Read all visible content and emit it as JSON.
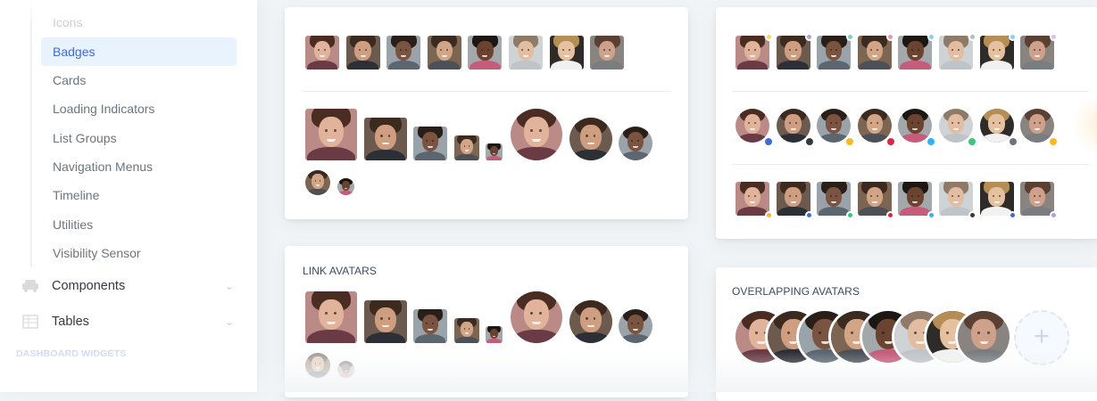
{
  "sidebar": {
    "items": [
      {
        "label": "Icons",
        "state": "faded"
      },
      {
        "label": "Badges",
        "state": "active"
      },
      {
        "label": "Cards"
      },
      {
        "label": "Loading Indicators"
      },
      {
        "label": "List Groups"
      },
      {
        "label": "Navigation Menus"
      },
      {
        "label": "Timeline"
      },
      {
        "label": "Utilities"
      },
      {
        "label": "Visibility Sensor"
      }
    ],
    "groups": [
      {
        "label": "Components",
        "icon": "car-icon"
      },
      {
        "label": "Tables",
        "icon": "table-icon"
      }
    ],
    "section_heading": "DASHBOARD WIDGETS"
  },
  "cards": {
    "link_avatars_title": "LINK AVATARS",
    "overlapping_avatars_title": "OVERLAPPING AVATARS",
    "add_button_label": "+"
  },
  "people": [
    {
      "id": "p1",
      "bg": "#b98a86",
      "skin": "#e0b39a",
      "hair": "#4a2c22",
      "shirt": "#6b3b45"
    },
    {
      "id": "p2",
      "bg": "#6d5a4e",
      "skin": "#cf9e80",
      "hair": "#3c2a1f",
      "shirt": "#2d2f36"
    },
    {
      "id": "p3",
      "bg": "#9aa3a9",
      "skin": "#7a5440",
      "hair": "#2a1e18",
      "shirt": "#5b6670"
    },
    {
      "id": "p4",
      "bg": "#7c6651",
      "skin": "#d3a587",
      "hair": "#3a2a20",
      "shirt": "#4c5057"
    },
    {
      "id": "p5",
      "bg": "#a3a8ab",
      "skin": "#6a4331",
      "hair": "#1d1714",
      "shirt": "#c55c7c"
    },
    {
      "id": "p6",
      "bg": "#cfd3d6",
      "skin": "#e2bda2",
      "hair": "#8e7a66",
      "shirt": "#bfc4c9"
    },
    {
      "id": "p7",
      "bg": "#2e2b28",
      "skin": "#e6c19f",
      "hair": "#b58e55",
      "shirt": "#f1f1f1"
    },
    {
      "id": "p8",
      "bg": "#8a8480",
      "skin": "#cfa18a",
      "hair": "#5a4032",
      "shirt": "#7a7d80"
    }
  ],
  "status_colors": {
    "primary": "#3f6ad8",
    "dark": "#343a40",
    "warning": "#f7b924",
    "danger": "#d92550",
    "info": "#30b1ff",
    "success": "#3ac47d",
    "secondary": "#6c757d",
    "light_info": "#78c3fb",
    "alt": "#16aaff",
    "pink": "#f48fb1",
    "purple": "#b39ddb",
    "teal": "#5ed8c0"
  },
  "rows": {
    "top_square_dots": [
      "#ffd54f",
      "#b39ddb",
      "#80cbc4",
      "#f48fb1",
      "#90caf9",
      "#b0bec5",
      "#90caf9",
      "#d1c4e9"
    ],
    "round_dots": [
      "primary",
      "dark",
      "warning",
      "danger",
      "info",
      "success",
      "secondary",
      "warning"
    ],
    "bottom_square_dots": [
      "warning",
      "primary",
      "success",
      "danger",
      "info",
      "dark",
      "primary",
      "purple"
    ]
  }
}
